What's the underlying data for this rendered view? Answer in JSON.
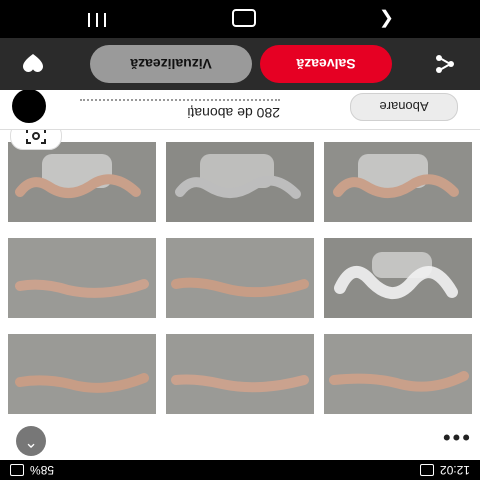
{
  "status_bar": {
    "time": "12:02",
    "right_status": "58%"
  },
  "action_bar": {
    "view_label": "Vizualizează",
    "save_label": "Salvează"
  },
  "profile": {
    "followers_text": "280 de abonați",
    "follow_label": "Abonare"
  },
  "grid": {
    "tiles": [
      {
        "subject": "hand-holding-glass",
        "tone": "color"
      },
      {
        "subject": "hand-holding-glass",
        "tone": "grayscale"
      },
      {
        "subject": "hand-holding-glass",
        "tone": "color"
      },
      {
        "subject": "hand-relaxed",
        "tone": "color"
      },
      {
        "subject": "hand-relaxed",
        "tone": "color"
      },
      {
        "subject": "hand-holding-glass",
        "tone": "color"
      },
      {
        "subject": "hand-relaxed",
        "tone": "color"
      },
      {
        "subject": "hand-relaxed",
        "tone": "color"
      },
      {
        "subject": "hand-relaxed",
        "tone": "color"
      }
    ]
  },
  "icons": {
    "share": "share-icon",
    "pinterest": "pinterest-heart-icon",
    "lens": "visual-search-icon",
    "more": "more-icon",
    "up": "chevron-up-icon"
  },
  "colors": {
    "save": "#e60023",
    "view": "#9a9a9a",
    "bar": "#2b2b2b"
  }
}
